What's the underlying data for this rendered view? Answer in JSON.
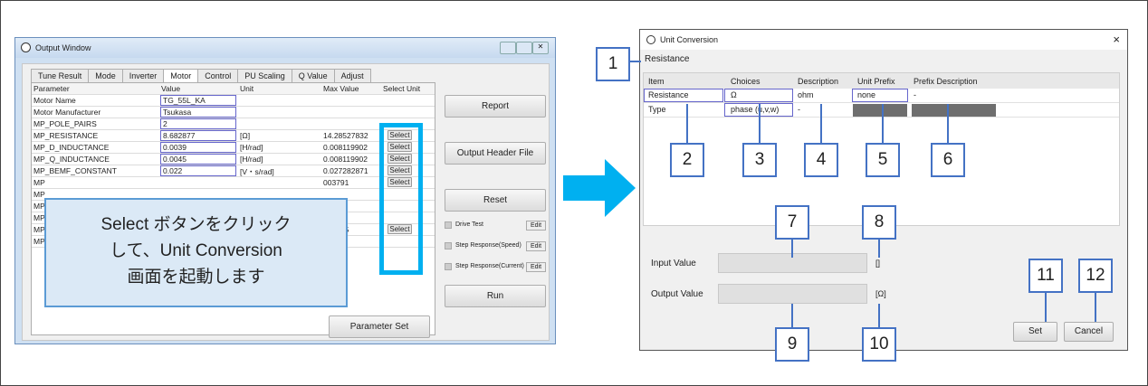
{
  "left_window": {
    "title": "Output Window",
    "tabs": [
      "Tune Result",
      "Mode",
      "Inverter",
      "Motor",
      "Control",
      "PU Scaling",
      "Q Value",
      "Adjust"
    ],
    "active_tab": "Motor",
    "columns": [
      "Parameter",
      "Value",
      "Unit",
      "Max Value",
      "Select Unit"
    ],
    "rows": [
      {
        "param": "Motor Name",
        "value": "TG_55L_KA",
        "unit": "",
        "max": "",
        "select": ""
      },
      {
        "param": "Motor Manufacturer",
        "value": "Tsukasa",
        "unit": "",
        "max": "",
        "select": ""
      },
      {
        "param": "MP_POLE_PAIRS",
        "value": "2",
        "unit": "",
        "max": "",
        "select": ""
      },
      {
        "param": "MP_RESISTANCE",
        "value": "8.682877",
        "unit": "[Ω]",
        "max": "14.28527832",
        "select": "Select"
      },
      {
        "param": "MP_D_INDUCTANCE",
        "value": "0.0039",
        "unit": "[H/rad]",
        "max": "0.008119902",
        "select": "Select"
      },
      {
        "param": "MP_Q_INDUCTANCE",
        "value": "0.0045",
        "unit": "[H/rad]",
        "max": "0.008119902",
        "select": "Select"
      },
      {
        "param": "MP_BEMF_CONSTANT",
        "value": "0.022",
        "unit": "[V・s/rad]",
        "max": "0.027282871",
        "select": "Select"
      },
      {
        "param": "MP",
        "value": "",
        "unit": "",
        "max": "003791",
        "select": "Select"
      },
      {
        "param": "MP",
        "value": "",
        "unit": "",
        "max": "",
        "select": ""
      },
      {
        "param": "MP",
        "value": "",
        "unit": "",
        "max": "",
        "select": ""
      },
      {
        "param": "MP",
        "value": "",
        "unit": "",
        "max": "48730",
        "select": ""
      },
      {
        "param": "MP",
        "value": "",
        "unit": "",
        "max": "743655",
        "select": "Select"
      },
      {
        "param": "MP",
        "value": "",
        "unit": "",
        "max": "",
        "select": ""
      }
    ],
    "buttons": {
      "report": "Report",
      "output_header": "Output Header File",
      "reset": "Reset",
      "run": "Run",
      "parameter_set": "Parameter Set"
    },
    "checks": [
      {
        "label": "Drive Test",
        "edit": "Edit"
      },
      {
        "label": "Step Response(Speed)",
        "edit": "Edit"
      },
      {
        "label": "Step Response(Current)",
        "edit": "Edit"
      }
    ],
    "callout": [
      "Select ボタンをクリック",
      "して、Unit Conversion",
      "画面を起動します"
    ]
  },
  "dialog": {
    "title": "Unit Conversion",
    "close": "×",
    "item_label": "Resistance",
    "columns": [
      "Item",
      "Choices",
      "Description",
      "Unit Prefix",
      "Prefix Description"
    ],
    "rows": [
      {
        "item": "Resistance",
        "choice": "Ω",
        "description": "ohm",
        "prefix": "none",
        "prefix_desc": "-"
      },
      {
        "item": "Type",
        "choice": "phase (u,v,w)",
        "description": "-",
        "prefix": "",
        "prefix_desc": ""
      }
    ],
    "input_label": "Input Value",
    "input_unit": "[]",
    "output_label": "Output Value",
    "output_unit": "[Ω]",
    "set": "Set",
    "cancel": "Cancel"
  },
  "markers": [
    "1",
    "2",
    "3",
    "4",
    "5",
    "6",
    "7",
    "8",
    "9",
    "10",
    "11",
    "12"
  ],
  "colors": {
    "highlight": "#00b0f0",
    "marker_border": "#4472c4",
    "callout_bg": "#dbe9f6"
  }
}
